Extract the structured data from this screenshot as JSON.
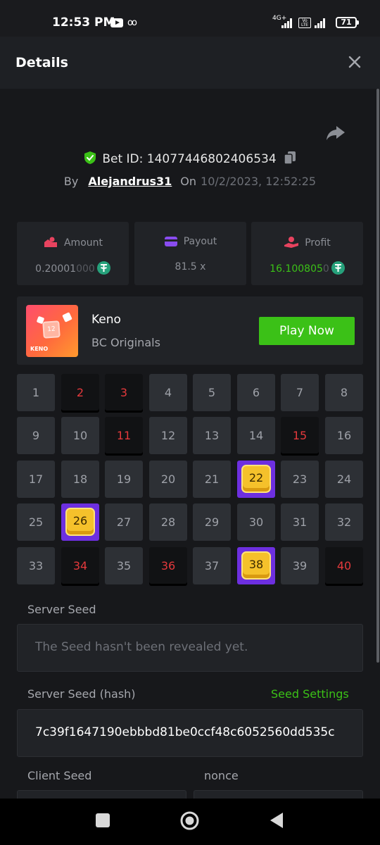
{
  "status_bar": {
    "time": "12:53 PM",
    "network_label": "4G+",
    "volte_label": "Vo LTE",
    "battery": "71",
    "icons": [
      "youtube-icon",
      "voicemail-icon",
      "signal-icon",
      "battery-icon"
    ]
  },
  "header": {
    "title": "Details",
    "close_icon": "close-icon"
  },
  "bet": {
    "id_label": "Bet ID: 14077446802406534",
    "by_label": "By",
    "username": "Alejandrus31",
    "on_label": "On",
    "date": "10/2/2023, 12:52:25"
  },
  "stats": {
    "amount": {
      "label": "Amount",
      "value_main": "0.20001",
      "value_faint": "000",
      "currency_icon": "usdt-icon"
    },
    "payout": {
      "label": "Payout",
      "value": "81.5 x"
    },
    "profit": {
      "label": "Profit",
      "value_main": "16.100805",
      "value_faint": "0",
      "currency_icon": "usdt-icon"
    }
  },
  "game": {
    "name": "Keno",
    "provider": "BC Originals",
    "thumb_label": "KENO",
    "thumb_tile": "12",
    "play_label": "Play Now"
  },
  "grid": {
    "numbers": [
      1,
      2,
      3,
      4,
      5,
      6,
      7,
      8,
      9,
      10,
      11,
      12,
      13,
      14,
      15,
      16,
      17,
      18,
      19,
      20,
      21,
      22,
      23,
      24,
      25,
      26,
      27,
      28,
      29,
      30,
      31,
      32,
      33,
      34,
      35,
      36,
      37,
      38,
      39,
      40
    ],
    "miss": [
      2,
      3,
      11,
      15,
      34,
      36,
      40
    ],
    "hit": [
      22,
      26,
      38
    ]
  },
  "seeds": {
    "server_seed_label": "Server Seed",
    "server_seed_value": "The Seed hasn't been revealed yet.",
    "server_hash_label": "Server Seed (hash)",
    "seed_settings_label": "Seed Settings",
    "server_hash_value": "7c39f1647190ebbbd81be0ccf48c6052560dd535c",
    "client_seed_label": "Client Seed",
    "nonce_label": "nonce"
  },
  "colors": {
    "accent_green": "#3bc117",
    "miss_red": "#e4393c",
    "hit_purple": "#6d2fe0",
    "gem_yellow": "#f5c12b"
  }
}
